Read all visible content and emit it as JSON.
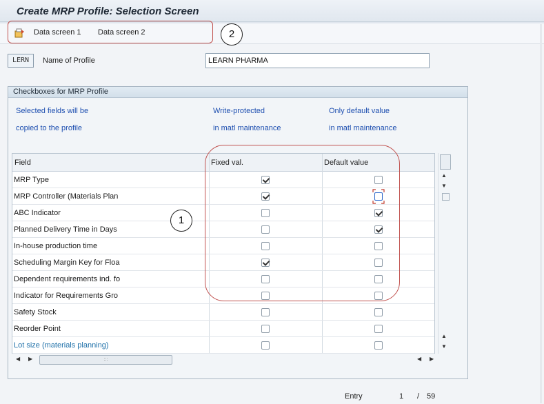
{
  "window": {
    "title": "Create MRP Profile: Selection Screen"
  },
  "toolbar": {
    "icon": "data-screen-icon",
    "items": [
      {
        "label": "Data screen 1"
      },
      {
        "label": "Data screen 2"
      }
    ]
  },
  "annotations": {
    "marker1": "1",
    "marker2": "2",
    "color": "#c0504d"
  },
  "profile": {
    "key": "LERN",
    "name_label": "Name of Profile",
    "name_value": "LEARN PHARMA"
  },
  "group": {
    "title": "Checkboxes for MRP Profile",
    "note_col1_line1": "Selected fields will be",
    "note_col1_line2": "copied to the profile",
    "note_col2_line1": "Write-protected",
    "note_col2_line2": "in matl maintenance",
    "note_col3_line1": "Only default value",
    "note_col3_line2": "in matl maintenance"
  },
  "table": {
    "headers": {
      "field": "Field",
      "fixed": "Fixed val.",
      "default": "Default value"
    },
    "rows": [
      {
        "field": "MRP Type",
        "fixed": true,
        "default": false
      },
      {
        "field": "MRP Controller (Materials Plan",
        "fixed": true,
        "default": false,
        "focused": true
      },
      {
        "field": "ABC Indicator",
        "fixed": false,
        "default": true
      },
      {
        "field": "Planned Delivery Time in Days",
        "fixed": false,
        "default": true
      },
      {
        "field": "In-house production time",
        "fixed": false,
        "default": false
      },
      {
        "field": "Scheduling Margin Key for Floa",
        "fixed": true,
        "default": false
      },
      {
        "field": "Dependent requirements ind. fo",
        "fixed": false,
        "default": false
      },
      {
        "field": "Indicator for Requirements Gro",
        "fixed": false,
        "default": false
      },
      {
        "field": "Safety Stock",
        "fixed": false,
        "default": false
      },
      {
        "field": "Reorder Point",
        "fixed": false,
        "default": false
      },
      {
        "field": "Lot size (materials planning)",
        "fixed": false,
        "default": false,
        "link": true
      }
    ]
  },
  "status": {
    "entry_label": "Entry",
    "current": "1",
    "separator": "/",
    "total": "59"
  }
}
